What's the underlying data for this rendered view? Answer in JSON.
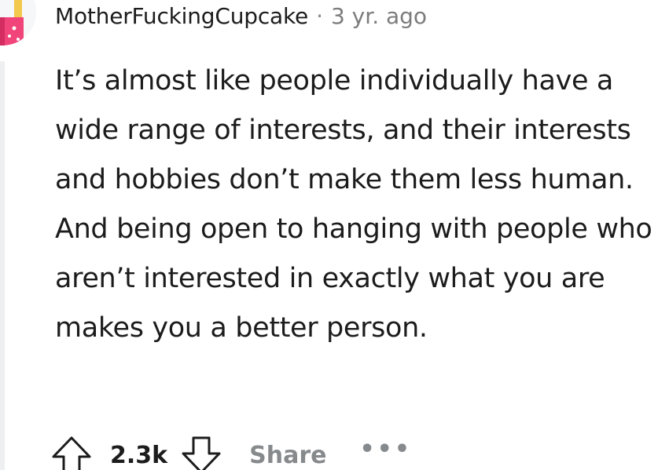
{
  "comment": {
    "author": "MotherFuckingCupcake",
    "separator": "·",
    "timestamp": "3 yr. ago",
    "body": "It’s almost like people individually have a wide range of interests, and their interests and hobbies don’t make them less human. And being open to hanging with people who aren’t interested in exactly what you are makes you a better person.",
    "score": "2.3k",
    "share_label": "Share",
    "more_label": "•••"
  },
  "icons": {
    "upvote": "upvote-arrow-icon",
    "downvote": "downvote-arrow-icon",
    "more": "more-options-icon",
    "avatar": "cupcake-avatar"
  },
  "colors": {
    "text": "#1c1c1c",
    "meta": "#878a8c",
    "thread_line": "#edeff1",
    "avatar_pink": "#f0447a"
  }
}
